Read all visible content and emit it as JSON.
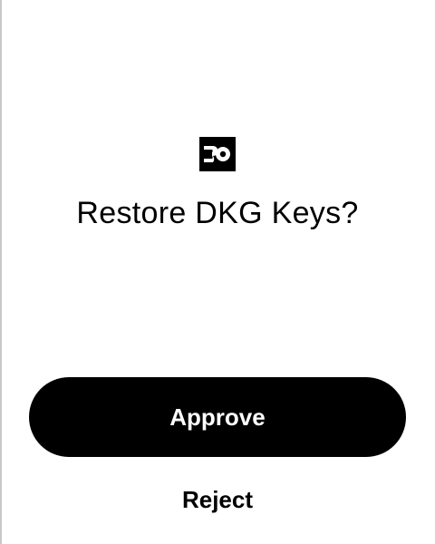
{
  "app": {
    "logo_icon": "brand-logo-icon"
  },
  "prompt": {
    "title": "Restore DKG Keys?"
  },
  "actions": {
    "approve_label": "Approve",
    "reject_label": "Reject"
  },
  "colors": {
    "primary": "#000000",
    "background": "#ffffff",
    "button_text": "#ffffff"
  }
}
